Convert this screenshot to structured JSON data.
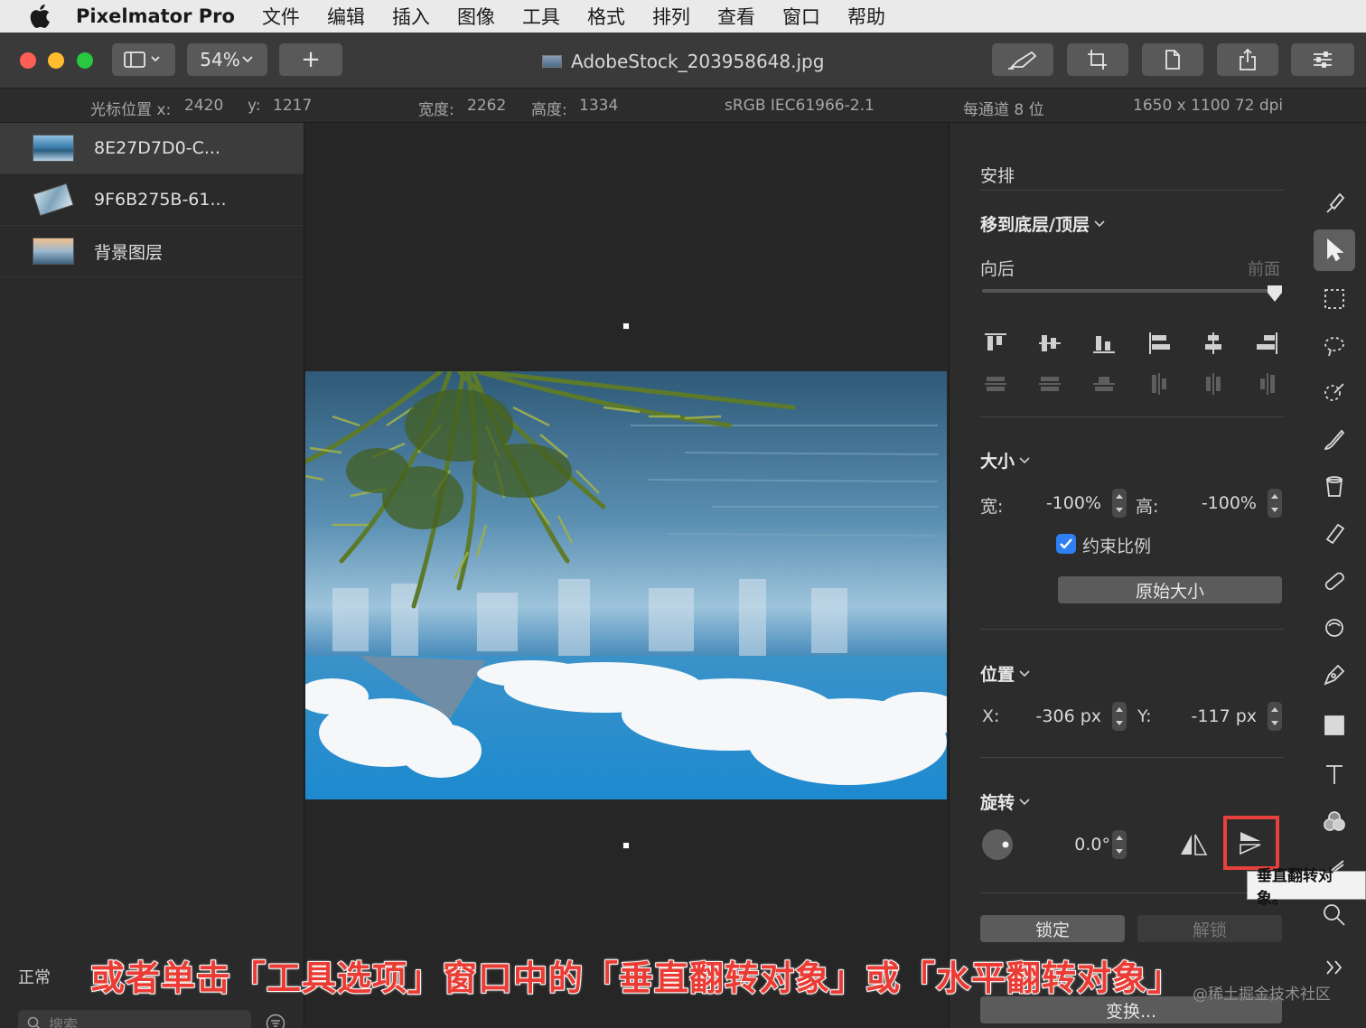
{
  "menubar": {
    "app_name": "Pixelmator Pro",
    "items": [
      "文件",
      "编辑",
      "插入",
      "图像",
      "工具",
      "格式",
      "排列",
      "查看",
      "窗口",
      "帮助"
    ]
  },
  "toolbar": {
    "zoom": "54%",
    "add_label": "+",
    "doc_title": "AdobeStock_203958648.jpg"
  },
  "infobar": {
    "cursor_x_label": "光标位置 x:",
    "cursor_x": "2420",
    "cursor_y_label": "y:",
    "cursor_y": "1217",
    "width_label": "宽度:",
    "width": "2262",
    "height_label": "高度:",
    "height": "1334",
    "color_profile": "sRGB IEC61966-2.1",
    "bit_depth": "每通道 8 位",
    "image_size": "1650 x 1100 72 dpi"
  },
  "layers": {
    "items": [
      {
        "name": "8E27D7D0-C..."
      },
      {
        "name": "9F6B275B-61..."
      },
      {
        "name": "背景图层"
      }
    ],
    "blend_mode": "正常",
    "search_placeholder": "搜索"
  },
  "panel": {
    "section_title": "安排",
    "arrange_menu": "移到底层/顶层",
    "back_label": "向后",
    "front_label": "前面",
    "size_head": "大小",
    "width_label": "宽:",
    "width_value": "-100%",
    "height_label": "高:",
    "height_value": "-100%",
    "constrain_label": "约束比例",
    "constrain_checked": true,
    "original_size": "原始大小",
    "position_head": "位置",
    "x_label": "X:",
    "x_value": "-306 px",
    "y_label": "Y:",
    "y_value": "-117 px",
    "rotate_head": "旋转",
    "rotate_value": "0.0°",
    "lock": "锁定",
    "unlock": "解锁",
    "transform": "变换..."
  },
  "tooltip": "垂直翻转对象。",
  "caption": "或者单击「工具选项」窗口中的「垂直翻转对象」或「水平翻转对象」",
  "watermark": "@稀土掘金技术社区",
  "colors": {
    "accent_highlight": "#e8413b",
    "checkbox": "#2f7ff5"
  }
}
